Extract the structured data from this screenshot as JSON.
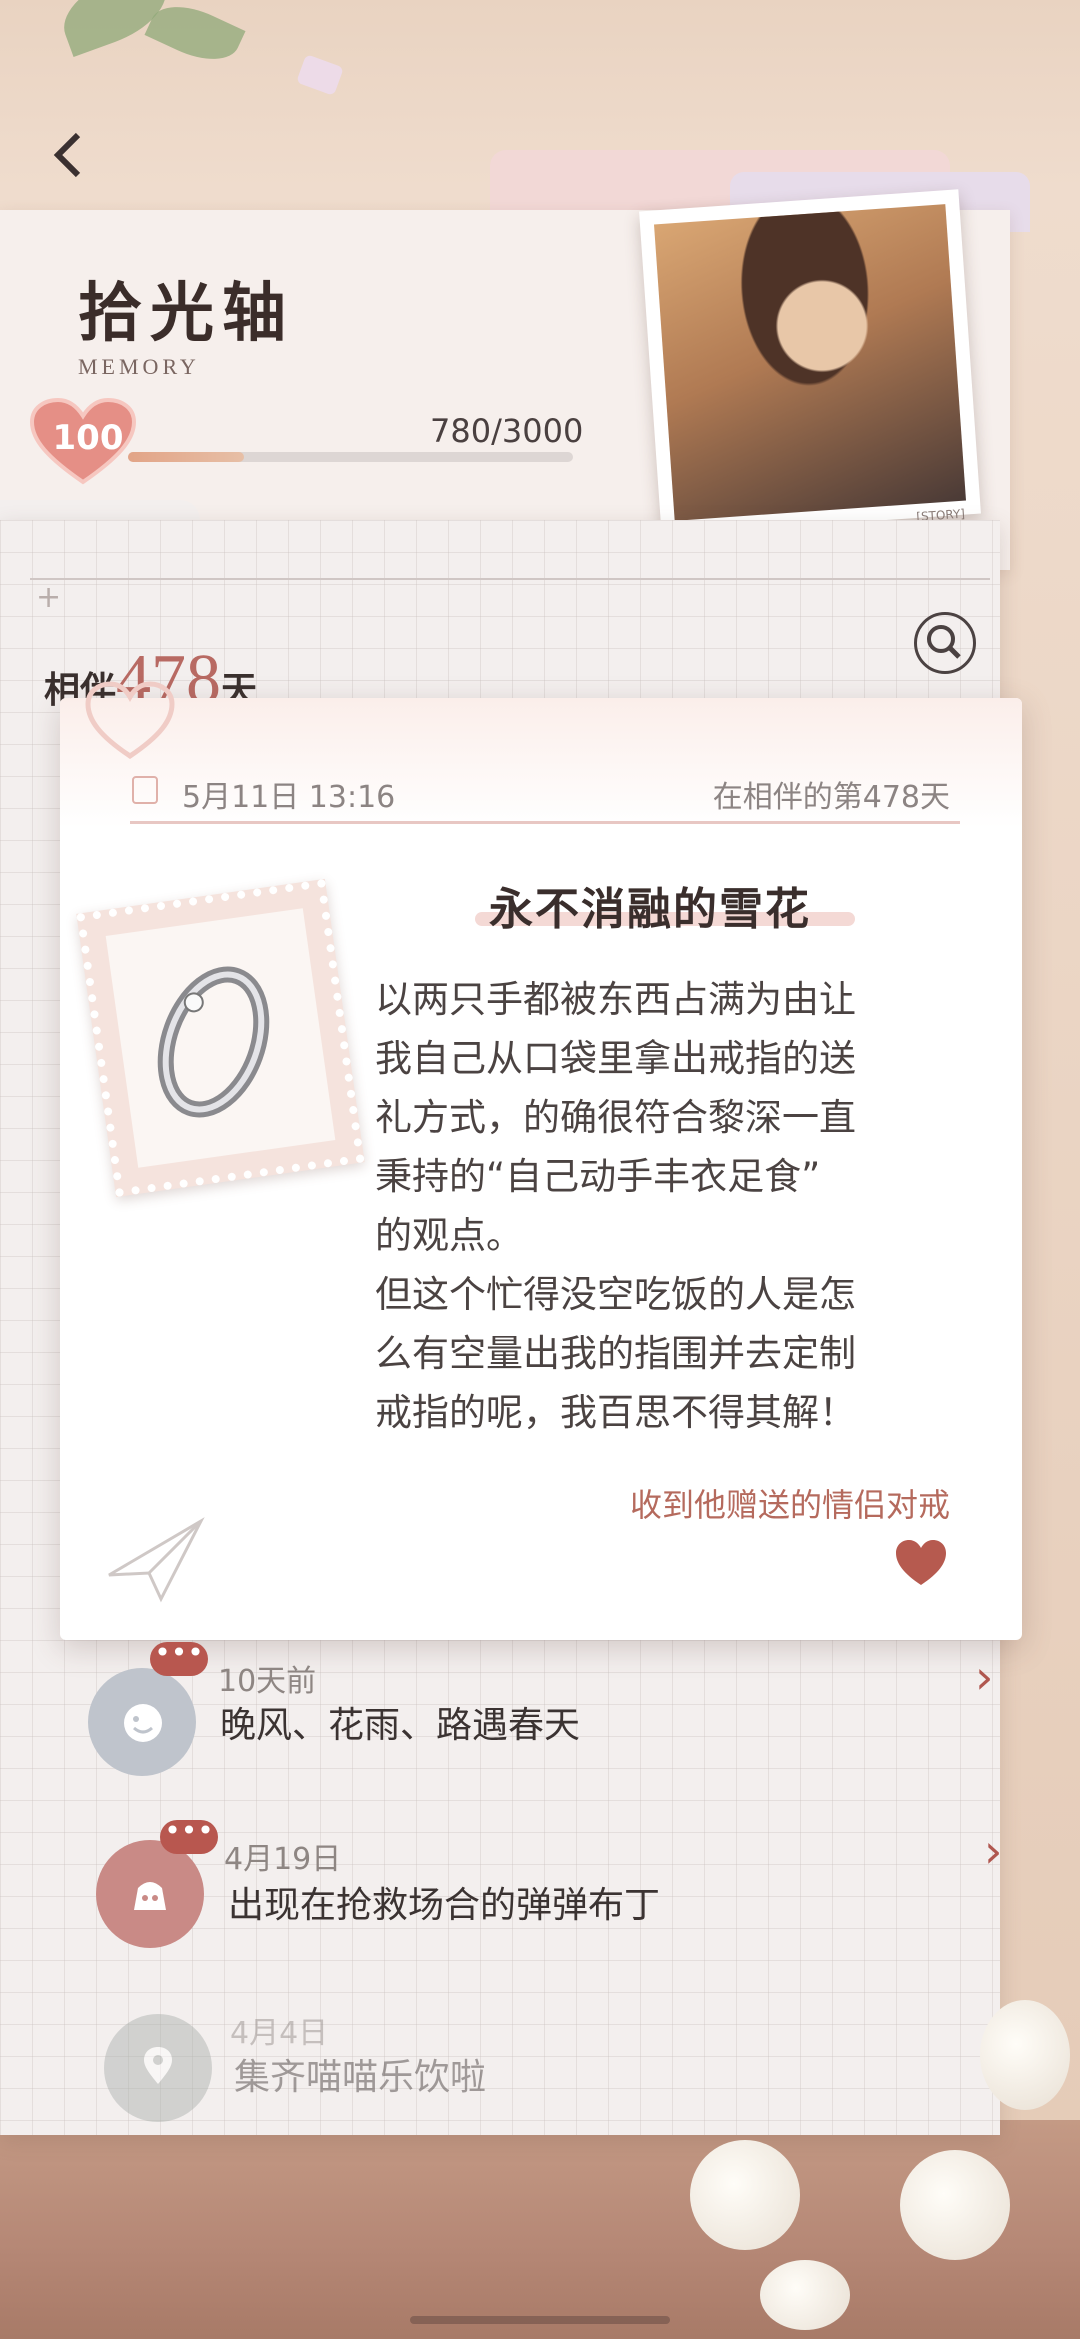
{
  "header": {
    "back_icon": "chevron-left-icon",
    "title": "拾光轴",
    "title_sub": "MEMORY",
    "level": "100",
    "progress_text": "780/3000",
    "progress_value": 0.26,
    "photo_tag": "[STORY]"
  },
  "companion": {
    "prefix": "相伴",
    "days": "478",
    "suffix": "天",
    "search_icon": "search-icon"
  },
  "popup": {
    "date": "5月11日 13:16",
    "day_text": "在相伴的第478天",
    "title": "永不消融的雪花",
    "body": "以两只手都被东西占满为由让\n我自己从口袋里拿出戒指的送\n礼方式，的确很符合黎深一直\n秉持的“自己动手丰衣足食”\n的观点。\n但这个忙得没空吃饭的人是怎\n么有空量出我的指围并去定制\n戒指的呢，我百思不得其解！",
    "footer": "收到他赠送的情侣对戒",
    "heart_icon": "heart-icon",
    "plane_icon": "paper-plane-icon",
    "item_image": "ring-image"
  },
  "list": [
    {
      "date": "10天前",
      "title": "晚风、花雨、路遇春天",
      "icon": "smile-face-icon",
      "color": "#bfc4cc"
    },
    {
      "date": "4月19日",
      "title": "出现在抢救场合的弹弹布丁",
      "icon": "pudding-icon",
      "color": "#c98a86"
    },
    {
      "date": "4月4日",
      "title": "集齐喵喵乐饮啦",
      "icon": "location-pin-icon",
      "color": "#a8aeaa"
    }
  ],
  "bubble_text": "•••",
  "colors": {
    "accent": "#b8574f",
    "text": "#3b3332"
  }
}
